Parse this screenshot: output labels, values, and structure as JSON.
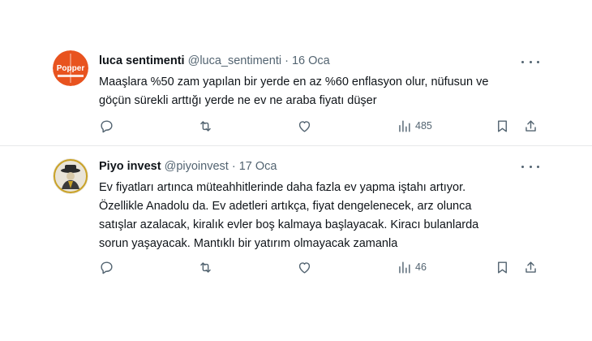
{
  "tweets": [
    {
      "author_name": "luca sentimenti",
      "handle": "@luca_sentimenti",
      "separator": "·",
      "date": "16 Oca",
      "avatar_text": "Popper",
      "avatar_color": "#e8531f",
      "text_lines": [
        "Maaşlara %50 zam yapılan bir yerde en az %60 enflasyon olur, nüfusun ve",
        "göçün sürekli arttığı yerde ne ev ne araba fiyatı düşer"
      ],
      "views": "485"
    },
    {
      "author_name": "Piyo invest",
      "handle": "@piyoinvest",
      "separator": "·",
      "date": "17 Oca",
      "avatar_color": "#c9a227",
      "text_lines": [
        "Ev fiyatları artınca müteahhitlerinde daha fazla ev yapma iştahı artıyor.",
        "Özellikle Anadolu da. Ev adetleri artıkça, fiyat dengelenecek, arz olunca",
        "satışlar azalacak, kiralık evler boş kalmaya başlayacak. Kiracı bulanlarda",
        "sorun yaşayacak. Mantıklı bir yatırım olmayacak zamanla"
      ],
      "views": "46"
    }
  ],
  "icons": {
    "reply": "reply-icon",
    "retweet": "retweet-icon",
    "like": "heart-icon",
    "views": "views-chart-icon",
    "bookmark": "bookmark-icon",
    "share": "share-icon",
    "more": "more-icon"
  }
}
